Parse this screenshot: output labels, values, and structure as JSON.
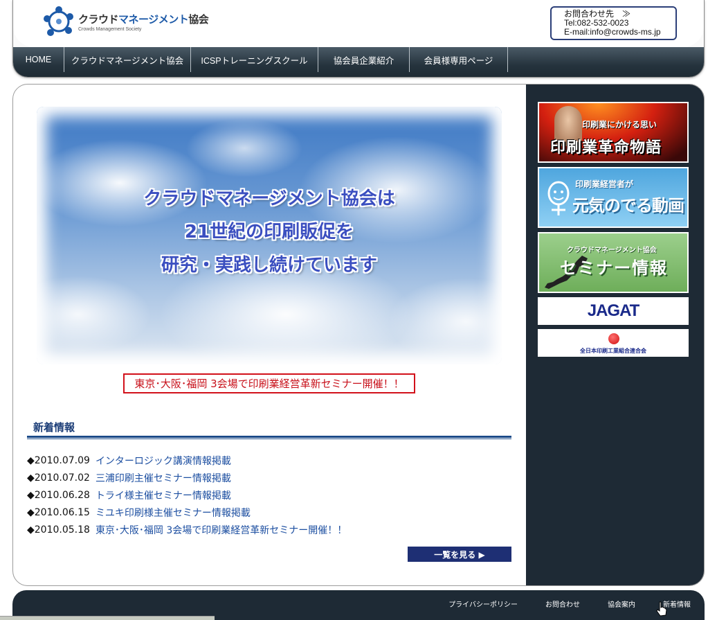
{
  "header": {
    "logo_title_part1": "クラウド",
    "logo_title_part2": "マネージメント",
    "logo_title_part3": "協会",
    "logo_subtitle": "Crowds Management Society",
    "contact": {
      "label": "お問合わせ先　≫",
      "tel": "Tel:082-532-0023",
      "email": "E-mail:info@crowds-ms.jp"
    }
  },
  "nav": {
    "items": [
      {
        "label": "HOME"
      },
      {
        "label": "クラウドマネージメント協会"
      },
      {
        "label": "ICSPトレーニングスクール"
      },
      {
        "label": "協会員企業紹介"
      },
      {
        "label": "会員様専用ページ"
      }
    ]
  },
  "hero": {
    "line1": "クラウドマネージメント協会は",
    "line2": "21世紀の印刷販促を",
    "line3": "研究・実践し続けています"
  },
  "notice": "東京･大阪･福岡 3会場で印刷業経営革新セミナー開催！！",
  "news": {
    "title": "新着情報",
    "items": [
      {
        "date": "◆2010.07.09",
        "text": "インターロジック講演情報掲載"
      },
      {
        "date": "◆2010.07.02",
        "text": "三浦印刷主催セミナー情報掲載"
      },
      {
        "date": "◆2010.06.28",
        "text": "トライ様主催セミナー情報掲載"
      },
      {
        "date": "◆2010.06.15",
        "text": "ミユキ印刷様主催セミナー情報掲載"
      },
      {
        "date": "◆2010.05.18",
        "text": "東京･大阪･福岡 3会場で印刷業経営革新セミナー開催！！"
      }
    ],
    "more_label": "一覧を見る ▶"
  },
  "sidebar": {
    "banner1_small": "印刷業にかける思い",
    "banner1_big": "印刷業革命物語",
    "banner2_small": "印刷業経営者が",
    "banner2_big": "元気のでる動画",
    "banner3_small": "クラウドマネージメント協会",
    "banner3_big": "セミナー情報",
    "banner4_logo": "JAGAT",
    "banner5_text": "全日本印刷工業組合連合会"
  },
  "footer": {
    "links": [
      {
        "label": "プライバシーポリシー"
      },
      {
        "label": "お問合わせ"
      },
      {
        "label": "協会案内"
      },
      {
        "label": "新着情報"
      }
    ]
  },
  "colors": {
    "nav_bg": "#25333d",
    "sidebar_bg": "#1e2a35",
    "link": "#1d4fa1",
    "notice_red": "#d2101a",
    "heading_navy": "#1b3d77"
  }
}
